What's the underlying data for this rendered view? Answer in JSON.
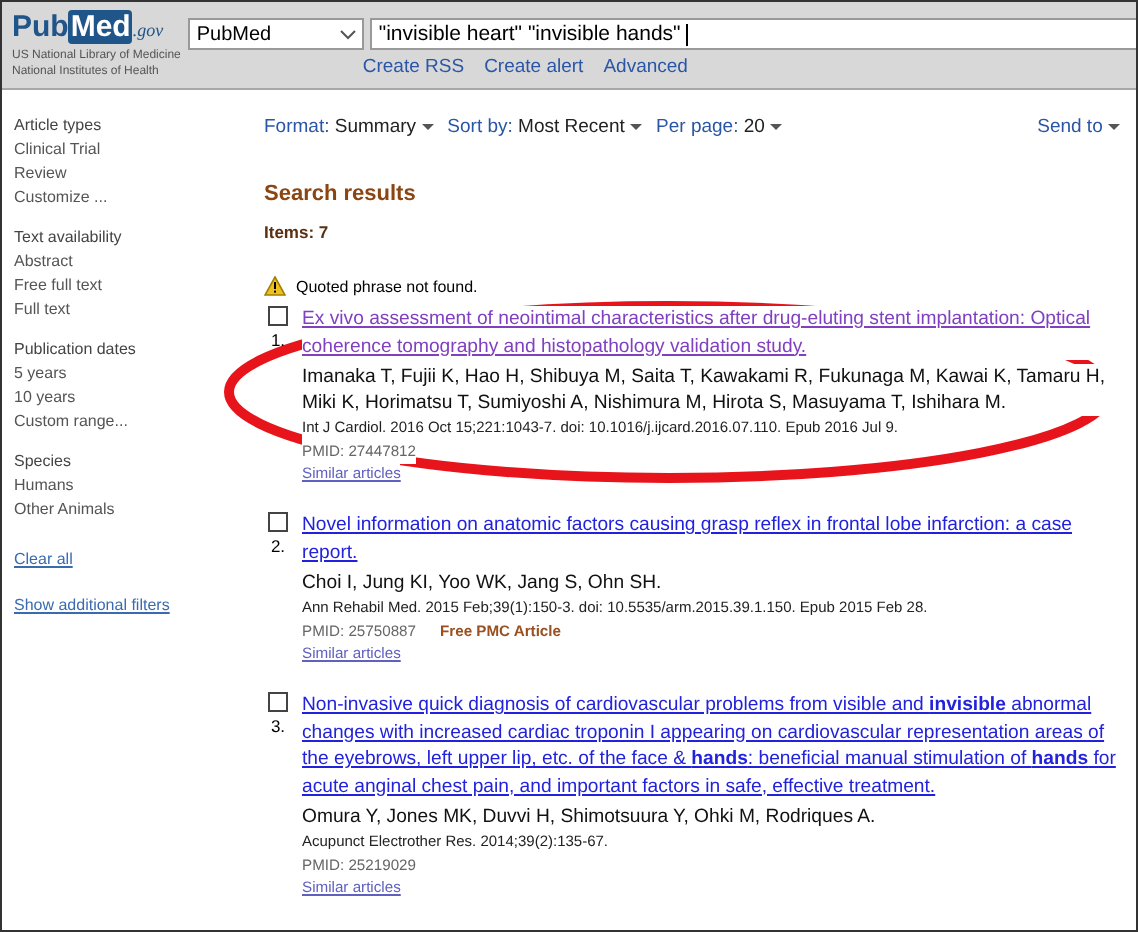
{
  "header": {
    "logo": {
      "part_1": "Pub",
      "part_2": "Med",
      "part_3": ".gov"
    },
    "org_lines": [
      "US National Library of Medicine",
      "National Institutes of Health"
    ],
    "database": "PubMed",
    "query": "\"invisible heart\" \"invisible hands\"",
    "links": [
      "Create RSS",
      "Create alert",
      "Advanced"
    ]
  },
  "sidebar": {
    "groups": [
      {
        "title": "Article types",
        "items": [
          "Clinical Trial",
          "Review",
          "Customize ..."
        ]
      },
      {
        "title": "Text availability",
        "items": [
          "Abstract",
          "Free full text",
          "Full text"
        ]
      },
      {
        "title": "Publication dates",
        "items": [
          "5 years",
          "10 years",
          "Custom range..."
        ]
      },
      {
        "title": "Species",
        "items": [
          "Humans",
          "Other Animals"
        ]
      }
    ],
    "links": [
      "Clear all",
      "Show additional filters"
    ]
  },
  "toolbar": [
    {
      "label": "Format:",
      "value": "Summary"
    },
    {
      "label": "Sort by:",
      "value": "Most Recent"
    },
    {
      "label": "Per page:",
      "value": "20"
    }
  ],
  "send_to": "Send to",
  "results_title": "Search results",
  "items_count": "Items: 7",
  "warning": "Quoted phrase not found.",
  "results": [
    {
      "number": "1.",
      "checked": false,
      "visited": true,
      "title": "Ex vivo assessment of neointimal characteristics after drug-eluting stent implantation: Optical coherence tomography and histopathology validation study.",
      "authors": "Imanaka T, Fujii K, Hao H, Shibuya M, Saita T, Kawakami R, Fukunaga M, Kawai K, Tamaru H, Miki K, Horimatsu T, Sumiyoshi A, Nishimura M, Hirota S, Masuyama T, Ishihara M.",
      "citation": "Int J Cardiol. 2016 Oct 15;221:1043-7. doi: 10.1016/j.ijcard.2016.07.110. Epub 2016 Jul 9.",
      "pmid": "PMID: 27447812",
      "similar": "Similar articles"
    },
    {
      "number": "2.",
      "checked": false,
      "visited": false,
      "title": "Novel information on anatomic factors causing grasp reflex in frontal lobe infarction: a case report.",
      "authors": "Choi I, Jung KI, Yoo WK, Jang S, Ohn SH.",
      "citation": "Ann Rehabil Med. 2015 Feb;39(1):150-3. doi: 10.5535/arm.2015.39.1.150. Epub 2015 Feb 28.",
      "pmid": "PMID: 25750887",
      "free": "Free PMC Article",
      "similar": "Similar articles"
    },
    {
      "number": "3.",
      "checked": false,
      "visited": false,
      "title": "Non-invasive quick diagnosis of cardiovascular problems from visible and **invisible** abnormal changes with increased cardiac troponin I appearing on cardiovascular representation areas of the eyebrows, left upper lip, etc. of the face & **hands**: beneficial manual stimulation of **hands** for acute anginal chest pain, and important factors in safe, effective treatment.",
      "authors": "Omura Y, Jones MK, Duvvi H, Shimotsuura Y, Ohki M, Rodriques A.",
      "citation": "Acupunct Electrother Res. 2014;39(2):135-67.",
      "pmid": "PMID: 25219029",
      "similar": "Similar articles"
    }
  ]
}
